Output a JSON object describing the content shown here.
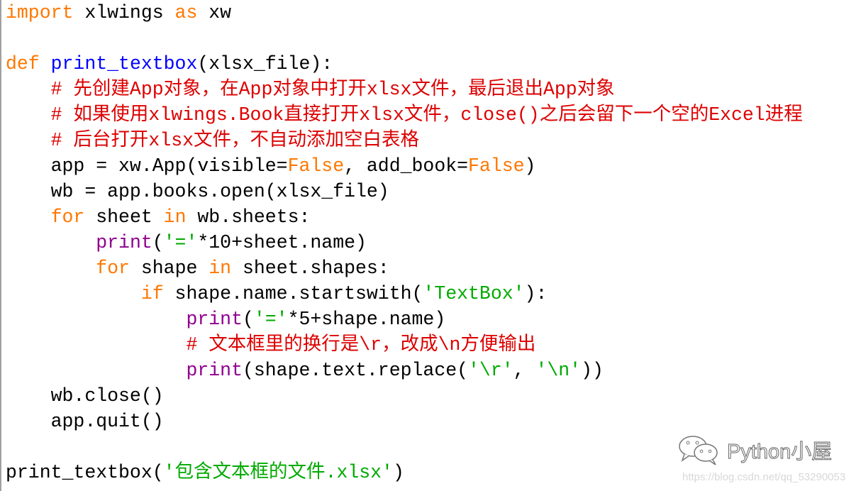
{
  "colors": {
    "keyword": "#ff7700",
    "function": "#0000ff",
    "builtin": "#900090",
    "string": "#00aa00",
    "comment": "#dd0000"
  },
  "code_lines": [
    [
      [
        "kw",
        "import"
      ],
      [
        "tx",
        " xlwings "
      ],
      [
        "kw",
        "as"
      ],
      [
        "tx",
        " xw"
      ]
    ],
    [],
    [
      [
        "kw",
        "def"
      ],
      [
        "tx",
        " "
      ],
      [
        "fn",
        "print_textbox"
      ],
      [
        "tx",
        "(xlsx_file):"
      ]
    ],
    [
      [
        "tx",
        "    "
      ],
      [
        "cm",
        "# 先创建App对象，在App对象中打开xlsx文件，最后退出App对象"
      ]
    ],
    [
      [
        "tx",
        "    "
      ],
      [
        "cm",
        "# 如果使用xlwings.Book直接打开xlsx文件，close()之后会留下一个空的Excel进程"
      ]
    ],
    [
      [
        "tx",
        "    "
      ],
      [
        "cm",
        "# 后台打开xlsx文件，不自动添加空白表格"
      ]
    ],
    [
      [
        "tx",
        "    app = xw.App(visible="
      ],
      [
        "kw",
        "False"
      ],
      [
        "tx",
        ", add_book="
      ],
      [
        "kw",
        "False"
      ],
      [
        "tx",
        ")"
      ]
    ],
    [
      [
        "tx",
        "    wb = app.books.open(xlsx_file)"
      ]
    ],
    [
      [
        "tx",
        "    "
      ],
      [
        "kw",
        "for"
      ],
      [
        "tx",
        " sheet "
      ],
      [
        "kw",
        "in"
      ],
      [
        "tx",
        " wb.sheets:"
      ]
    ],
    [
      [
        "tx",
        "        "
      ],
      [
        "bi",
        "print"
      ],
      [
        "tx",
        "("
      ],
      [
        "st",
        "'='"
      ],
      [
        "tx",
        "*10+sheet.name)"
      ]
    ],
    [
      [
        "tx",
        "        "
      ],
      [
        "kw",
        "for"
      ],
      [
        "tx",
        " shape "
      ],
      [
        "kw",
        "in"
      ],
      [
        "tx",
        " sheet.shapes:"
      ]
    ],
    [
      [
        "tx",
        "            "
      ],
      [
        "kw",
        "if"
      ],
      [
        "tx",
        " shape.name.startswith("
      ],
      [
        "st",
        "'TextBox'"
      ],
      [
        "tx",
        "):"
      ]
    ],
    [
      [
        "tx",
        "                "
      ],
      [
        "bi",
        "print"
      ],
      [
        "tx",
        "("
      ],
      [
        "st",
        "'='"
      ],
      [
        "tx",
        "*5+shape.name)"
      ]
    ],
    [
      [
        "tx",
        "                "
      ],
      [
        "cm",
        "# 文本框里的换行是\\r，改成\\n方便输出"
      ]
    ],
    [
      [
        "tx",
        "                "
      ],
      [
        "bi",
        "print"
      ],
      [
        "tx",
        "(shape.text.replace("
      ],
      [
        "st",
        "'\\r'"
      ],
      [
        "tx",
        ", "
      ],
      [
        "st",
        "'\\n'"
      ],
      [
        "tx",
        "))"
      ]
    ],
    [
      [
        "tx",
        "    wb.close()"
      ]
    ],
    [
      [
        "tx",
        "    app.quit()"
      ]
    ],
    [],
    [
      [
        "tx",
        "print_textbox("
      ],
      [
        "st",
        "'包含文本框的文件.xlsx'"
      ],
      [
        "tx",
        ")"
      ]
    ]
  ],
  "watermark": {
    "icon": "wechat-icon",
    "text": "Python小屋",
    "url": "https://blog.csdn.net/qq_53290053"
  }
}
